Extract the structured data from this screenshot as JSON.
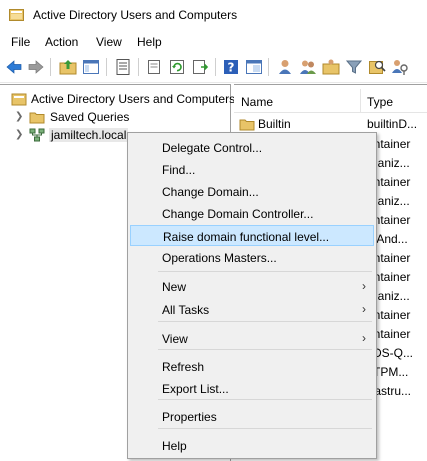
{
  "window": {
    "title": "Active Directory Users and Computers"
  },
  "menubar": {
    "items": [
      "File",
      "Action",
      "View",
      "Help"
    ]
  },
  "toolbar": {
    "buttons": [
      "back-icon",
      "forward-icon",
      "up-folder-icon",
      "show-hide-tree-icon",
      "properties-icon",
      "copy-icon",
      "refresh-icon",
      "export-icon",
      "help-icon",
      "console-icon",
      "new-user-icon",
      "new-group-icon",
      "new-ou-icon",
      "filter-icon",
      "find-icon",
      "delegate-icon"
    ]
  },
  "tree": {
    "root": "Active Directory Users and Computers",
    "items": [
      "Saved Queries",
      "jamiltech.local"
    ]
  },
  "list": {
    "columns": [
      "Name",
      "Type"
    ],
    "rows": [
      {
        "name": "Builtin",
        "type": "builtinD..."
      },
      {
        "name": "",
        "type": "ontainer"
      },
      {
        "name": "",
        "type": "rganiz..."
      },
      {
        "name": "",
        "type": "ontainer"
      },
      {
        "name": "",
        "type": "rganiz..."
      },
      {
        "name": "",
        "type": "ontainer"
      },
      {
        "name": "",
        "type": "stAnd..."
      },
      {
        "name": "",
        "type": "ontainer"
      },
      {
        "name": "",
        "type": "ontainer"
      },
      {
        "name": "",
        "type": "rganiz..."
      },
      {
        "name": "",
        "type": "ontainer"
      },
      {
        "name": "",
        "type": "ontainer"
      },
      {
        "name": "",
        "type": "sDS-Q..."
      },
      {
        "name": "",
        "type": "sTPM..."
      },
      {
        "name": "",
        "type": "frastru..."
      }
    ]
  },
  "context_menu": {
    "items": [
      {
        "label": "Delegate Control..."
      },
      {
        "label": "Find..."
      },
      {
        "label": "Change Domain..."
      },
      {
        "label": "Change Domain Controller..."
      },
      {
        "label": "Raise domain functional level...",
        "highlighted": true
      },
      {
        "label": "Operations Masters..."
      },
      {
        "label": "New",
        "submenu": true
      },
      {
        "label": "All Tasks",
        "submenu": true
      },
      {
        "label": "View",
        "submenu": true
      },
      {
        "label": "Refresh"
      },
      {
        "label": "Export List..."
      },
      {
        "label": "Properties"
      },
      {
        "label": "Help"
      }
    ]
  },
  "colors": {
    "highlight": "#cce8ff",
    "highlight_border": "#99d1ff",
    "menu_bg": "#f0f0f0",
    "folder": "#e8c468"
  }
}
